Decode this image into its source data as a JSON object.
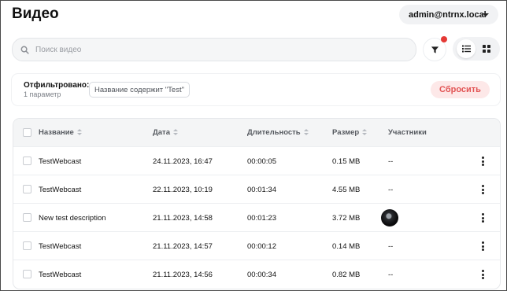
{
  "page": {
    "title": "Видео"
  },
  "account": {
    "label": "admin@ntrnx.local"
  },
  "search": {
    "placeholder": "Поиск видео",
    "value": ""
  },
  "icons": {
    "search": "search-icon",
    "filter": "filter-icon",
    "list_view": "list-view-icon",
    "grid_view": "grid-view-icon",
    "more": "kebab-menu-icon",
    "dropdown": "chevron-down-icon"
  },
  "filter_bar": {
    "label": "Отфильтровано:",
    "count": "1 параметр",
    "chip": "Название содержит \"Test\"",
    "reset_label": "Сбросить"
  },
  "colors": {
    "accent_red": "#e53935",
    "reset_bg": "#fde8e8",
    "reset_text": "#e25555"
  },
  "table": {
    "columns": [
      "Название",
      "Дата",
      "Длительность",
      "Размер",
      "Участники"
    ],
    "rows": [
      {
        "name": "TestWebcast",
        "date": "24.11.2023, 16:47",
        "duration": "00:00:05",
        "size": "0.15 MB",
        "participants": "--"
      },
      {
        "name": "TestWebcast",
        "date": "22.11.2023, 10:19",
        "duration": "00:01:34",
        "size": "4.55 MB",
        "participants": "--"
      },
      {
        "name": "New test description",
        "date": "21.11.2023, 14:58",
        "duration": "00:01:23",
        "size": "3.72 MB",
        "participants": ""
      },
      {
        "name": "TestWebcast",
        "date": "21.11.2023, 14:57",
        "duration": "00:00:12",
        "size": "0.14 MB",
        "participants": "--"
      },
      {
        "name": "TestWebcast",
        "date": "21.11.2023, 14:56",
        "duration": "00:00:34",
        "size": "0.82 MB",
        "participants": "--"
      }
    ]
  }
}
